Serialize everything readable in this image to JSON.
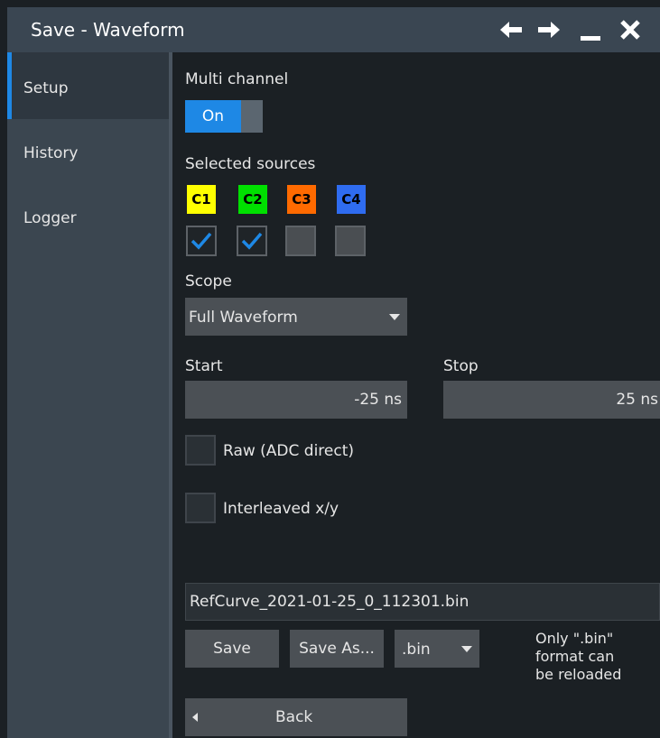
{
  "window": {
    "title": "Save - Waveform"
  },
  "titlebar_icons": [
    "arrow-left-icon",
    "arrow-right-icon",
    "minimize-icon",
    "close-icon"
  ],
  "sidebar": {
    "items": [
      {
        "label": "Setup",
        "active": true
      },
      {
        "label": "History",
        "active": false
      },
      {
        "label": "Logger",
        "active": false
      }
    ]
  },
  "setup": {
    "multi_channel_label": "Multi channel",
    "multi_channel_state": "On",
    "selected_sources_label": "Selected sources",
    "channels": [
      {
        "label": "C1",
        "color": "#ffff00",
        "text_color": "#000000",
        "checked": true
      },
      {
        "label": "C2",
        "color": "#00e000",
        "text_color": "#000000",
        "checked": true
      },
      {
        "label": "C3",
        "color": "#ff6a00",
        "text_color": "#000000",
        "checked": false
      },
      {
        "label": "C4",
        "color": "#2f6cf0",
        "text_color": "#000000",
        "checked": false
      }
    ],
    "scope_label": "Scope",
    "scope_value": "Full Waveform",
    "start_label": "Start",
    "start_value": "-25 ns",
    "stop_label": "Stop",
    "stop_value": "25 ns",
    "raw_label": "Raw (ADC direct)",
    "raw_checked": false,
    "interleaved_label": "Interleaved x/y",
    "interleaved_checked": false,
    "filename": "RefCurve_2021-01-25_0_112301.bin",
    "save_label": "Save",
    "save_as_label": "Save As...",
    "format_value": ".bin",
    "note_line1": "Only \".bin\"",
    "note_line2": "format can",
    "note_line3": "be reloaded",
    "back_label": "Back"
  },
  "colors": {
    "accent": "#1e88e5",
    "titlebar": "#3a4652",
    "sidebar": "#3b4650",
    "background": "#1b2024"
  }
}
